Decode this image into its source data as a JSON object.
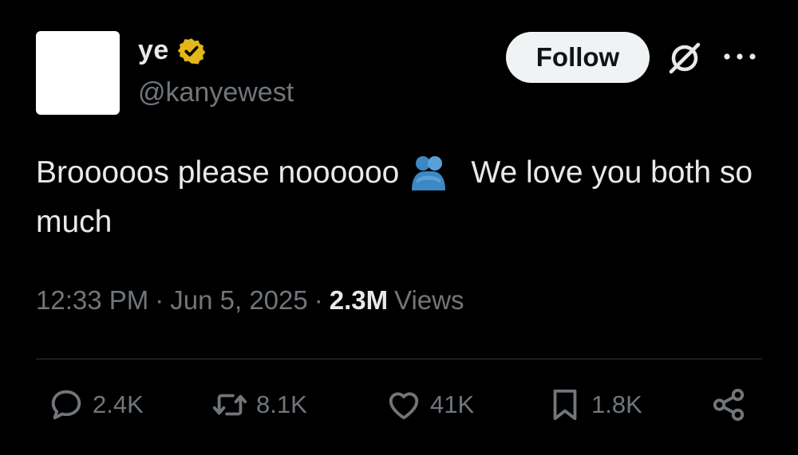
{
  "author": {
    "display_name": "ye",
    "handle": "@kanyewest",
    "verified": true
  },
  "follow_button": {
    "label": "Follow"
  },
  "icons": {
    "verified": "verified-badge-icon",
    "grok": "grok-icon",
    "more": "more-options-icon",
    "emoji": "people-hugging-emoji",
    "reply": "reply-icon",
    "retweet": "retweet-icon",
    "like": "like-icon",
    "bookmark": "bookmark-icon",
    "share": "share-icon"
  },
  "tweet": {
    "text_part1": "Brooooos please noooooo",
    "text_part2": "We love you both so much"
  },
  "meta": {
    "time": "12:33 PM",
    "separator": "·",
    "date": "Jun 5, 2025",
    "views_count": "2.3M",
    "views_label": "Views"
  },
  "actions": {
    "replies": "2.4K",
    "retweets": "8.1K",
    "likes": "41K",
    "bookmarks": "1.8K"
  },
  "colors": {
    "background": "#000000",
    "text": "#e7e9ea",
    "secondary": "#71767b",
    "verified_gold": "#e2b719",
    "follow_bg": "#eff3f4",
    "emoji_blue": "#3b88c3"
  }
}
